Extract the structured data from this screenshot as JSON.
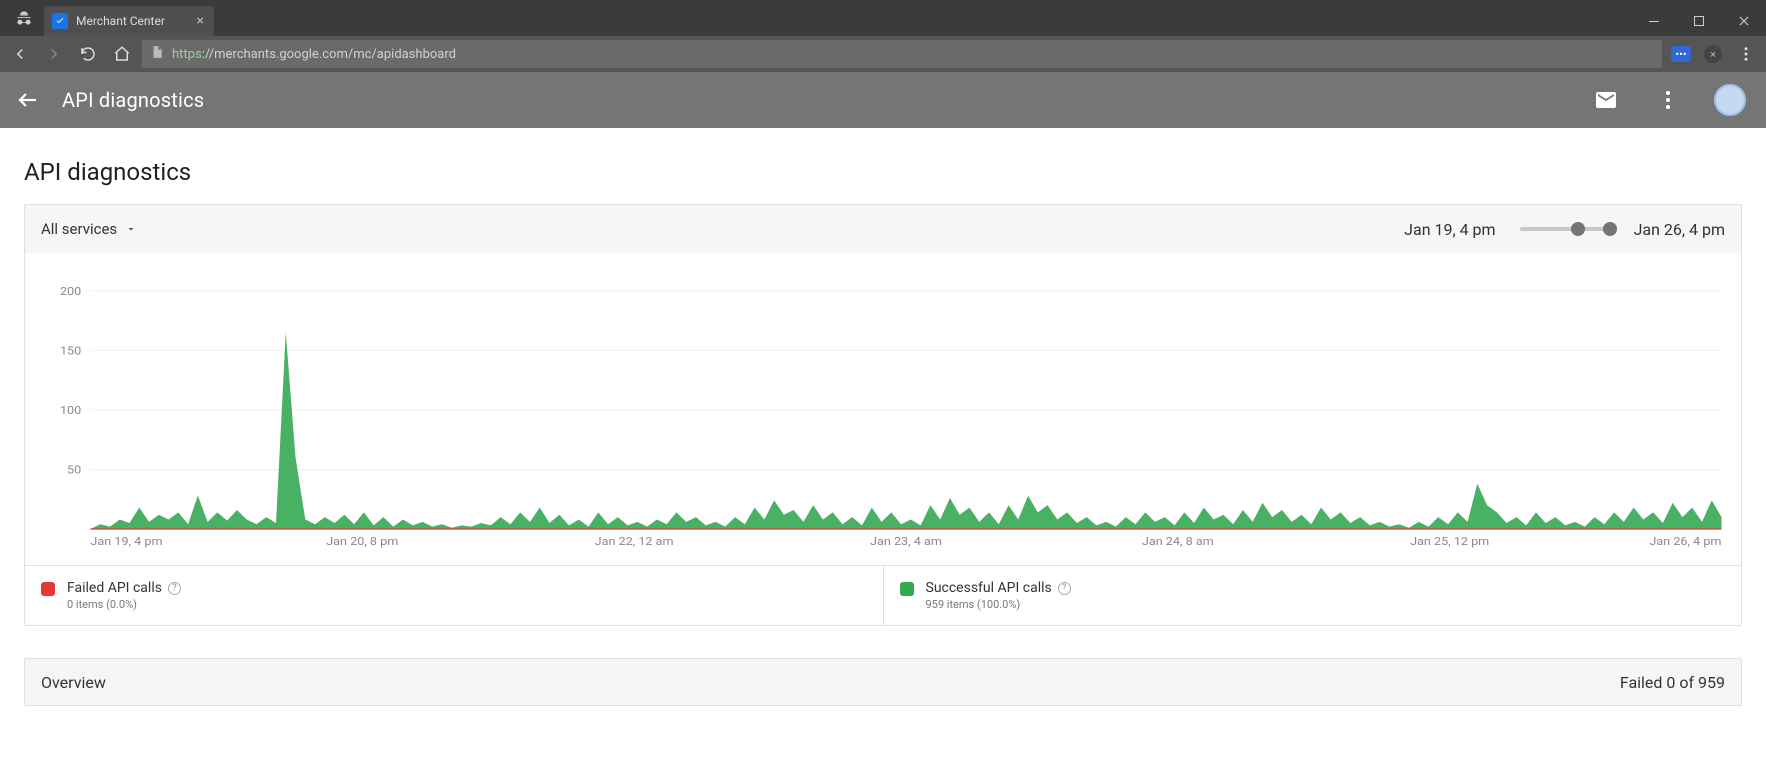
{
  "browser": {
    "tab_title": "Merchant Center",
    "url_display": "https://merchants.google.com/mc/apidashboard",
    "url_proto": "https",
    "url_rest": "://merchants.google.com/mc/apidashboard"
  },
  "appbar": {
    "title": "API diagnostics"
  },
  "page_title": "API diagnostics",
  "filter": {
    "service_label": "All services",
    "range_start": "Jan 19, 4 pm",
    "range_end": "Jan 26, 4 pm"
  },
  "legend": {
    "failed_title": "Failed API calls",
    "failed_sub": "0 items (0.0%)",
    "success_title": "Successful API calls",
    "success_sub": "959 items (100.0%)"
  },
  "overview": {
    "title": "Overview",
    "summary": "Failed 0 of 959"
  },
  "chart_data": {
    "type": "area",
    "ylabel": "",
    "xlabel": "",
    "ylim": [
      0,
      210
    ],
    "y_ticks": [
      50,
      100,
      150,
      200
    ],
    "x_ticks": [
      "Jan 19, 4 pm",
      "Jan 20, 8 pm",
      "Jan 22, 12 am",
      "Jan 23, 4 am",
      "Jan 24, 8 am",
      "Jan 25, 12 pm",
      "Jan 26, 4 pm"
    ],
    "series": [
      {
        "name": "Successful API calls",
        "color": "#34a853",
        "values": [
          0,
          4,
          2,
          8,
          5,
          18,
          6,
          12,
          8,
          14,
          4,
          28,
          6,
          14,
          7,
          16,
          8,
          4,
          10,
          5,
          165,
          60,
          8,
          4,
          10,
          5,
          12,
          4,
          14,
          3,
          10,
          2,
          8,
          3,
          6,
          2,
          4,
          1,
          3,
          2,
          5,
          3,
          10,
          4,
          14,
          6,
          18,
          5,
          12,
          3,
          8,
          2,
          14,
          4,
          10,
          3,
          6,
          2,
          8,
          4,
          14,
          6,
          10,
          3,
          6,
          2,
          10,
          4,
          18,
          8,
          24,
          12,
          16,
          6,
          20,
          8,
          14,
          4,
          10,
          3,
          18,
          6,
          14,
          4,
          8,
          3,
          20,
          8,
          26,
          12,
          18,
          6,
          14,
          4,
          20,
          8,
          28,
          14,
          20,
          8,
          14,
          5,
          10,
          3,
          6,
          2,
          10,
          4,
          14,
          6,
          10,
          3,
          14,
          5,
          18,
          8,
          12,
          4,
          16,
          6,
          22,
          10,
          16,
          6,
          12,
          4,
          18,
          8,
          14,
          5,
          10,
          3,
          6,
          2,
          4,
          1,
          6,
          2,
          10,
          4,
          14,
          6,
          38,
          20,
          14,
          5,
          10,
          3,
          14,
          5,
          10,
          3,
          6,
          2,
          10,
          4,
          14,
          6,
          18,
          8,
          14,
          5,
          22,
          10,
          18,
          6,
          24,
          10
        ]
      },
      {
        "name": "Failed API calls",
        "color": "#e53935",
        "values_all_zero": true,
        "count": 168
      }
    ]
  }
}
